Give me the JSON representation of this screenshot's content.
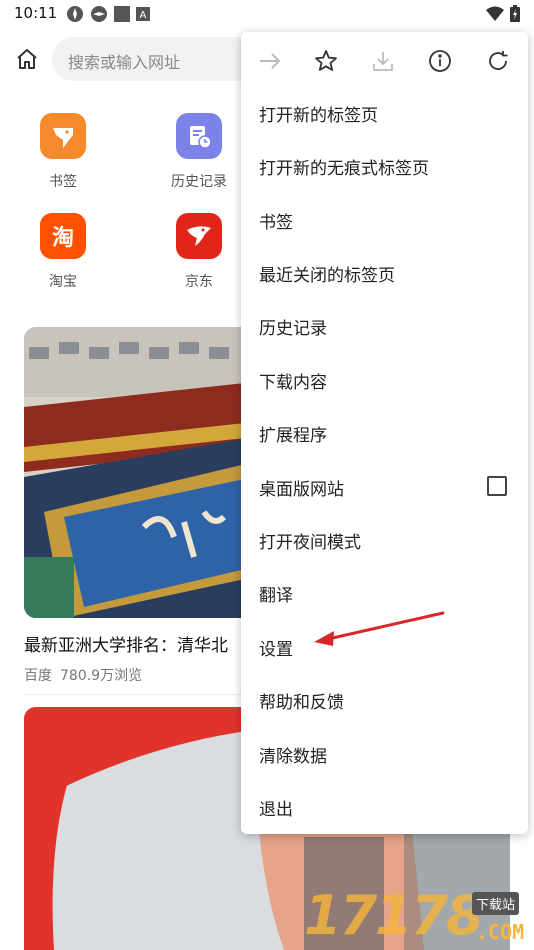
{
  "status_bar": {
    "time": "10:11"
  },
  "search": {
    "placeholder": "搜索或输入网址"
  },
  "shortcuts": [
    {
      "label": "书签",
      "icon": "bookmark-bird-icon",
      "color": "#f58a2c"
    },
    {
      "label": "历史记录",
      "icon": "history-clock-icon",
      "color": "#7b83e8"
    },
    {
      "label": "淘宝",
      "icon": "taobao-icon",
      "glyph": "淘",
      "color": "#ff5000"
    },
    {
      "label": "京东",
      "icon": "jd-dog-icon",
      "color": "#e1251b"
    }
  ],
  "feed": {
    "item1": {
      "title": "最新亚洲大学排名：清华北",
      "source": "百度",
      "views": "780.9万浏览"
    }
  },
  "menu": {
    "toolbar": [
      "forward-icon",
      "star-icon",
      "download-icon",
      "info-icon",
      "refresh-icon"
    ],
    "items": [
      {
        "label": "打开新的标签页"
      },
      {
        "label": "打开新的无痕式标签页"
      },
      {
        "label": "书签"
      },
      {
        "label": "最近关闭的标签页"
      },
      {
        "label": "历史记录"
      },
      {
        "label": "下载内容"
      },
      {
        "label": "扩展程序"
      },
      {
        "label": "桌面版网站",
        "checkbox": false
      },
      {
        "label": "打开夜间模式"
      },
      {
        "label": "翻译"
      },
      {
        "label": "设置"
      },
      {
        "label": "帮助和反馈"
      },
      {
        "label": "清除数据"
      },
      {
        "label": "退出"
      }
    ]
  },
  "watermark": {
    "digits": "17178",
    "tag": "下载站",
    "domain": ".COM"
  },
  "colors": {
    "annotation_arrow": "#d9262a",
    "menu_bg": "#ffffff"
  }
}
